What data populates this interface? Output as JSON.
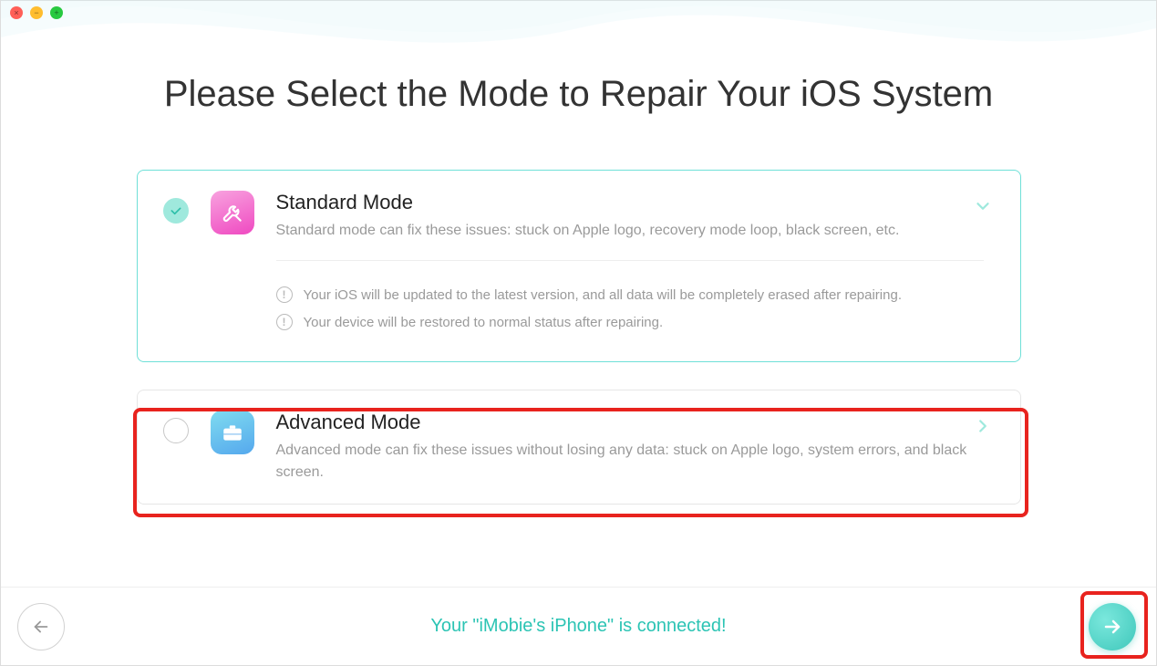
{
  "window": {
    "close": "×",
    "minimize": "−",
    "maximize": "+"
  },
  "title": "Please Select the Mode to Repair Your iOS System",
  "modes": {
    "standard": {
      "title": "Standard Mode",
      "desc": "Standard mode can fix these issues: stuck on Apple logo, recovery mode loop, black screen, etc.",
      "note1": "Your iOS will be updated to the latest version, and all data will be completely erased after repairing.",
      "note2": "Your device will be restored to normal status after repairing.",
      "selected": true
    },
    "advanced": {
      "title": "Advanced Mode",
      "desc": "Advanced mode can fix these issues without losing any data: stuck on Apple logo, system errors, and black screen.",
      "selected": false
    }
  },
  "status": "Your \"iMobie's iPhone\" is connected!",
  "colors": {
    "accent": "#2cc4b4",
    "highlight": "#e8231e"
  }
}
